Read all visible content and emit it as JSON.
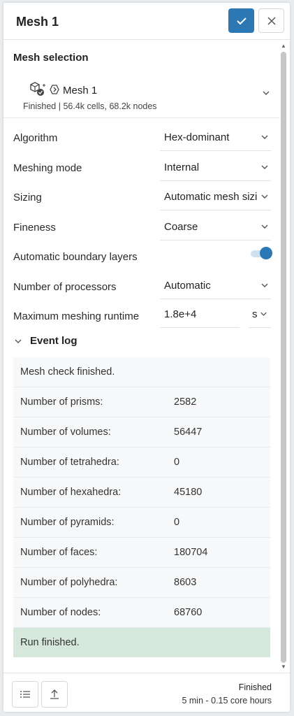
{
  "header": {
    "title": "Mesh 1"
  },
  "mesh_selection": {
    "title": "Mesh selection",
    "mesh_name": "Mesh 1",
    "mesh_status": "Finished | 56.4k cells, 68.2k nodes"
  },
  "settings": {
    "algorithm": {
      "label": "Algorithm",
      "value": "Hex-dominant"
    },
    "meshing_mode": {
      "label": "Meshing mode",
      "value": "Internal"
    },
    "sizing": {
      "label": "Sizing",
      "value": "Automatic mesh sizi"
    },
    "fineness": {
      "label": "Fineness",
      "value": "Coarse"
    },
    "boundary_layers": {
      "label": "Automatic boundary layers",
      "enabled": true
    },
    "processors": {
      "label": "Number of processors",
      "value": "Automatic"
    },
    "runtime": {
      "label": "Maximum meshing runtime",
      "value": "1.8e+4",
      "unit": "s"
    }
  },
  "event_log": {
    "title": "Event log",
    "first": "Mesh check finished.",
    "rows": [
      {
        "k": "Number of prisms:",
        "v": "2582"
      },
      {
        "k": "Number of volumes:",
        "v": "56447"
      },
      {
        "k": "Number of tetrahedra:",
        "v": "0"
      },
      {
        "k": "Number of hexahedra:",
        "v": "45180"
      },
      {
        "k": "Number of pyramids:",
        "v": "0"
      },
      {
        "k": "Number of faces:",
        "v": "180704"
      },
      {
        "k": "Number of polyhedra:",
        "v": "8603"
      },
      {
        "k": "Number of nodes:",
        "v": "68760"
      }
    ],
    "last": "Run finished."
  },
  "footer": {
    "status": "Finished",
    "detail": "5 min - 0.15 core hours"
  },
  "colors": {
    "accent": "#2b78b4",
    "success_bg": "#d6e8dc"
  },
  "icons": [
    "check-icon",
    "close-icon",
    "mesh-icon",
    "chevron-down-icon",
    "list-icon",
    "upload-icon"
  ]
}
